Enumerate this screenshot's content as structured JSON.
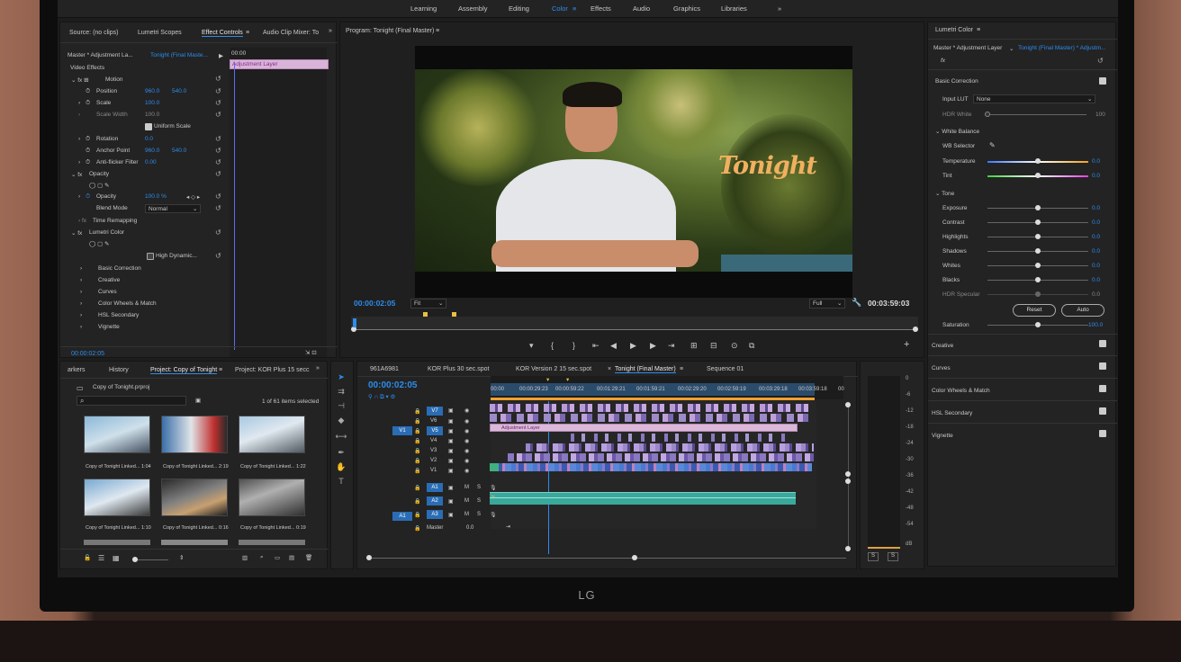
{
  "workspaces": [
    "Learning",
    "Assembly",
    "Editing",
    "Color",
    "Effects",
    "Audio",
    "Graphics",
    "Libraries"
  ],
  "workspace_active": "Color",
  "source_tabs": {
    "source": "Source: (no clips)",
    "scopes": "Lumetri Scopes",
    "effects": "Effect Controls",
    "mixer": "Audio Clip Mixer: To"
  },
  "ec": {
    "master": "Master * Adjustment La...",
    "seq": "Tonight (Final Maste...",
    "time0": "00:00",
    "clip": "Adjustment Layer",
    "video_effects": "Video Effects",
    "motion": "Motion",
    "position": "Position",
    "pos_x": "960.0",
    "pos_y": "540.0",
    "scale": "Scale",
    "scale_v": "100.0",
    "scale_width": "Scale Width",
    "scale_w_v": "100.0",
    "uniform": "Uniform Scale",
    "rotation": "Rotation",
    "rot_v": "0.0",
    "anchor": "Anchor Point",
    "anc_x": "960.0",
    "anc_y": "540.0",
    "flicker": "Anti-flicker Filter",
    "flicker_v": "0.00",
    "opacity": "Opacity",
    "opacity_row": "Opacity",
    "opacity_v": "100.0 %",
    "blend": "Blend Mode",
    "blend_v": "Normal",
    "time_remap": "Time Remapping",
    "lumetri": "Lumetri Color",
    "high_dyn": "High Dynamic...",
    "basic": "Basic Correction",
    "creative": "Creative",
    "curves": "Curves",
    "wheels": "Color Wheels & Match",
    "hsl": "HSL Secondary",
    "vignette": "Vignette",
    "timecode": "00:00:02:05"
  },
  "program": {
    "title": "Program: Tonight (Final Master)",
    "overlay": "Tonight",
    "timecode": "00:00:02:05",
    "fit": "Fit",
    "quality": "Full",
    "duration": "00:03:59:03"
  },
  "lumetri": {
    "title": "Lumetri Color",
    "master": "Master * Adjustment Layer",
    "seq": "Tonight (Final Master) * Adjustm...",
    "fx": "fx",
    "basic": "Basic Correction",
    "input_lut": "Input LUT",
    "lut_v": "None",
    "hdr_white": "HDR White",
    "hdr_v": "100",
    "wb": "White Balance",
    "wb_selector": "WB Selector",
    "temperature": "Temperature",
    "temp_v": "0.0",
    "tint": "Tint",
    "tint_v": "0.0",
    "tone": "Tone",
    "exposure": "Exposure",
    "exp_v": "0.0",
    "contrast": "Contrast",
    "con_v": "0.0",
    "highlights": "Highlights",
    "hi_v": "0.0",
    "shadows": "Shadows",
    "sh_v": "0.0",
    "whites": "Whites",
    "wh_v": "0.0",
    "blacks": "Blacks",
    "bl_v": "0.0",
    "hdr_spec": "HDR Specular",
    "hdrs_v": "0.0",
    "reset": "Reset",
    "auto": "Auto",
    "saturation": "Saturation",
    "sat_v": "100.0",
    "creative": "Creative",
    "curves": "Curves",
    "wheels": "Color Wheels & Match",
    "hsl": "HSL Secondary",
    "vignette": "Vignette"
  },
  "project": {
    "tabs": [
      "arkers",
      "History",
      "Project: Copy of Tonight",
      "Project: KOR Plus 15 secc"
    ],
    "file": "Copy of Tonight.prproj",
    "count": "1 of 61 items selected",
    "items": [
      {
        "name": "Copy of Tonight Linked...",
        "dur": "1:04"
      },
      {
        "name": "Copy of Tonight Linked...",
        "dur": "2:19"
      },
      {
        "name": "Copy of Tonight Linked...",
        "dur": "1:22"
      },
      {
        "name": "Copy of Tonight Linked...",
        "dur": "1:10"
      },
      {
        "name": "Copy of Tonight Linked...",
        "dur": "0:16"
      },
      {
        "name": "Copy of Tonight Linked...",
        "dur": "0:19"
      }
    ]
  },
  "timeline": {
    "tabs": [
      "961A6981",
      "KOR Plus 30 sec.spot",
      "KOR Version 2 15 sec.spot",
      "Tonight (Final Master)",
      "Sequence 01"
    ],
    "timecode": "00:00:02:05",
    "ruler": [
      "00:00",
      "00:00:29:23",
      "00:00:59:22",
      "00:01:29:21",
      "00:01:59:21",
      "00:02:29:20",
      "00:02:59:19",
      "00:03:29:18",
      "00:03:59:18",
      "00"
    ],
    "vtracks": [
      "V7",
      "V6",
      "V5",
      "V4",
      "V3",
      "V2",
      "V1"
    ],
    "atracks": [
      "A1",
      "A2",
      "A3"
    ],
    "src_v": "V1",
    "src_a": "A1",
    "master": "Master",
    "master_v": "0.0",
    "adj": "Adjustment Layer",
    "fx": "fx",
    "mute": "M",
    "solo": "S"
  },
  "meter": [
    "0",
    "-6",
    "-12",
    "-18",
    "-24",
    "-30",
    "-36",
    "-42",
    "-48",
    "-54",
    "dB"
  ],
  "meter_solo": "S",
  "brand": "LG"
}
